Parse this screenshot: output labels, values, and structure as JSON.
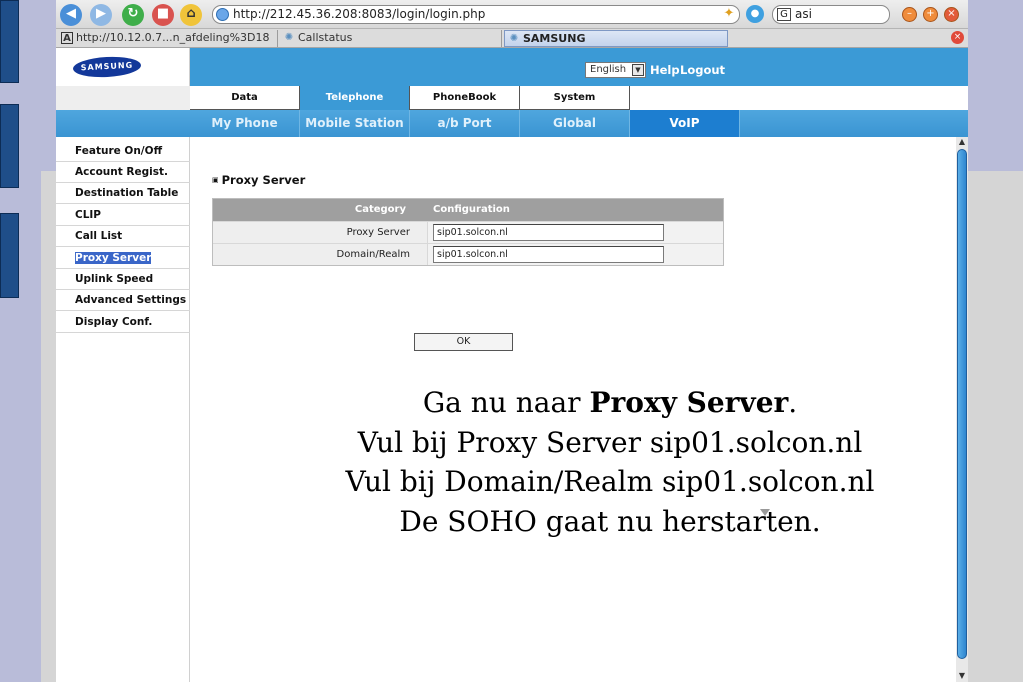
{
  "browser": {
    "url": "http://212.45.36.208:8083/login/login.php",
    "search_text": "asi",
    "tabs": [
      {
        "label": "http://10.12.0.7...n_afdeling%3D18",
        "icon": "A"
      },
      {
        "label": "Callstatus"
      },
      {
        "label": "SAMSUNG"
      }
    ]
  },
  "app": {
    "logo_text": "SAMSUNG",
    "language": "English",
    "help_label": "Help",
    "logout_label": "Logout",
    "main_tabs": [
      "Data",
      "Telephone",
      "PhoneBook",
      "System"
    ],
    "active_main_tab": "Telephone",
    "sub_tabs": [
      "My Phone",
      "Mobile Station",
      "a/b Port",
      "Global",
      "VoIP"
    ],
    "active_sub_tab": "VoIP",
    "sidebar": [
      "Feature On/Off",
      "Account Regist.",
      "Destination Table",
      "CLIP",
      "Call List",
      "Proxy Server",
      "Uplink Speed",
      "Advanced Settings",
      "Display Conf."
    ],
    "selected_sidebar": "Proxy Server"
  },
  "content": {
    "section_title": "Proxy Server",
    "table_headers": [
      "Category",
      "Configuration"
    ],
    "rows": [
      {
        "label": "Proxy Server",
        "value": "sip01.solcon.nl"
      },
      {
        "label": "Domain/Realm",
        "value": "sip01.solcon.nl"
      }
    ],
    "ok_label": "OK"
  },
  "slide": {
    "line1_prefix": "Ga nu naar ",
    "line1_bold": "Proxy Server",
    "line1_suffix": ".",
    "line2": "Vul bij Proxy Server sip01.solcon.nl",
    "line3": "Vul bij Domain/Realm sip01.solcon.nl",
    "line4": "De SOHO gaat nu herstarten."
  },
  "colors": {
    "accent_blue": "#3b9ad6",
    "active_subtab": "#1d7ed0",
    "sidebar_selected": "#3a66c8"
  }
}
